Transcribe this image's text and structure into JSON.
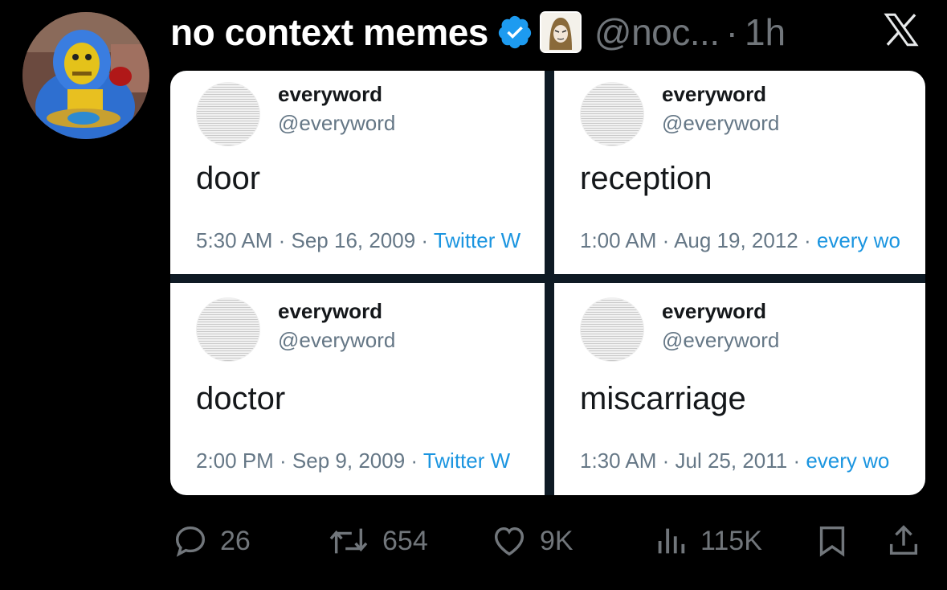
{
  "post": {
    "display_name": "no context memes",
    "handle": "@noc...",
    "separator": "·",
    "timestamp": "1h"
  },
  "media": {
    "tweets": [
      {
        "name": "everyword",
        "handle": "@everyword",
        "text": "door",
        "meta": "5:30 AM · Sep 16, 2009 · ",
        "source": "Twitter W"
      },
      {
        "name": "everyword",
        "handle": "@everyword",
        "text": "reception",
        "meta": "1:00 AM · Aug 19, 2012 · ",
        "source": "every wo"
      },
      {
        "name": "everyword",
        "handle": "@everyword",
        "text": "doctor",
        "meta": "2:00 PM · Sep 9, 2009 · ",
        "source": "Twitter W"
      },
      {
        "name": "everyword",
        "handle": "@everyword",
        "text": "miscarriage",
        "meta": "1:30 AM · Jul 25, 2011 · ",
        "source": "every wo"
      }
    ]
  },
  "actions": {
    "replies": "26",
    "reposts": "654",
    "likes": "9K",
    "views": "115K"
  },
  "colors": {
    "background": "#000000",
    "muted": "#71767b",
    "verified": "#1d9bf0",
    "link": "#1b95e0"
  },
  "icons": [
    "verified-badge-icon",
    "x-logo-icon",
    "reply-icon",
    "repost-icon",
    "like-icon",
    "views-icon",
    "bookmark-icon",
    "share-icon"
  ]
}
